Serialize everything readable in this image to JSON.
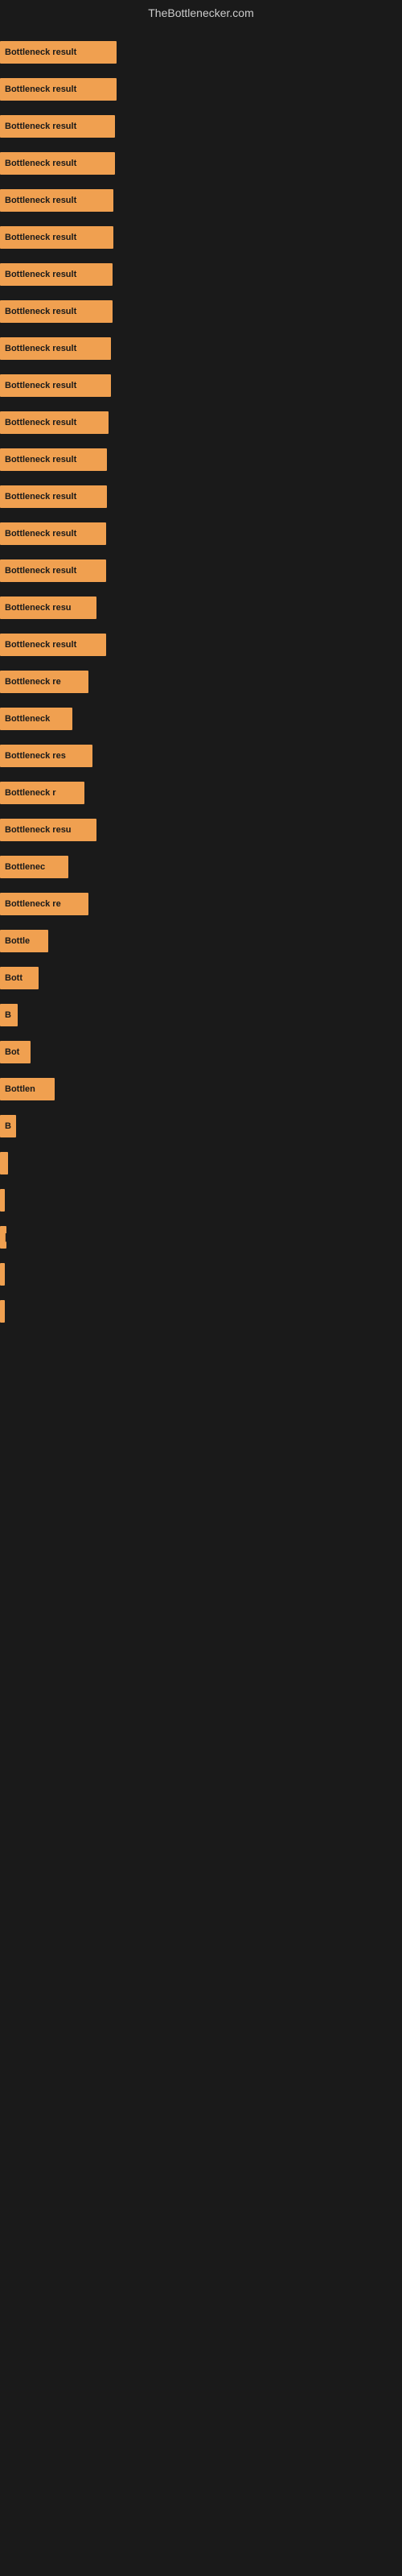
{
  "header": {
    "title": "TheBottlenecker.com"
  },
  "bars": [
    {
      "label": "Bottleneck result",
      "width": 145
    },
    {
      "label": "Bottleneck result",
      "width": 145
    },
    {
      "label": "Bottleneck result",
      "width": 143
    },
    {
      "label": "Bottleneck result",
      "width": 143
    },
    {
      "label": "Bottleneck result",
      "width": 141
    },
    {
      "label": "Bottleneck result",
      "width": 141
    },
    {
      "label": "Bottleneck result",
      "width": 140
    },
    {
      "label": "Bottleneck result",
      "width": 140
    },
    {
      "label": "Bottleneck result",
      "width": 138
    },
    {
      "label": "Bottleneck result",
      "width": 138
    },
    {
      "label": "Bottleneck result",
      "width": 135
    },
    {
      "label": "Bottleneck result",
      "width": 133
    },
    {
      "label": "Bottleneck result",
      "width": 133
    },
    {
      "label": "Bottleneck result",
      "width": 132
    },
    {
      "label": "Bottleneck result",
      "width": 132
    },
    {
      "label": "Bottleneck resu",
      "width": 120
    },
    {
      "label": "Bottleneck result",
      "width": 132
    },
    {
      "label": "Bottleneck re",
      "width": 110
    },
    {
      "label": "Bottleneck",
      "width": 90
    },
    {
      "label": "Bottleneck res",
      "width": 115
    },
    {
      "label": "Bottleneck r",
      "width": 105
    },
    {
      "label": "Bottleneck resu",
      "width": 120
    },
    {
      "label": "Bottlenec",
      "width": 85
    },
    {
      "label": "Bottleneck re",
      "width": 110
    },
    {
      "label": "Bottle",
      "width": 60
    },
    {
      "label": "Bott",
      "width": 48
    },
    {
      "label": "B",
      "width": 22
    },
    {
      "label": "Bot",
      "width": 38
    },
    {
      "label": "Bottlen",
      "width": 68
    },
    {
      "label": "B",
      "width": 20
    },
    {
      "label": "",
      "width": 10
    },
    {
      "label": "",
      "width": 6
    },
    {
      "label": "|",
      "width": 8
    },
    {
      "label": "",
      "width": 4
    },
    {
      "label": "",
      "width": 3
    }
  ]
}
